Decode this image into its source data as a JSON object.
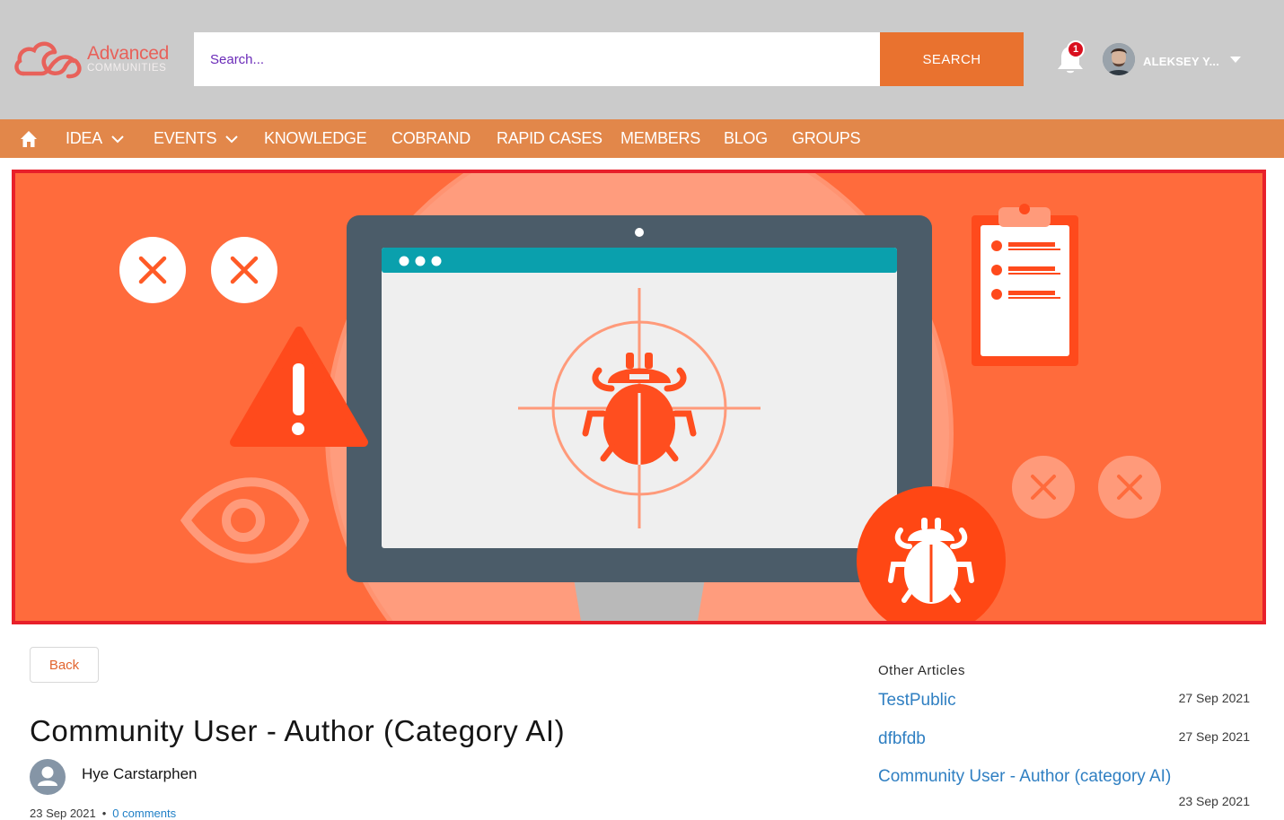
{
  "brand": {
    "line1": "Advanced",
    "line2": "COMMUNITIES",
    "logo_color": "#e8615a"
  },
  "search": {
    "placeholder": "Search...",
    "value": "",
    "button_label": "SEARCH",
    "button_color": "#e9722f"
  },
  "notifications": {
    "count": "1",
    "badge_color": "#d90f1e"
  },
  "user": {
    "name": "ALEKSEY Y..."
  },
  "nav": {
    "home_icon": "home-icon",
    "items": [
      {
        "label": "IDEA",
        "has_dropdown": true
      },
      {
        "label": "EVENTS",
        "has_dropdown": true
      },
      {
        "label": "KNOWLEDGE",
        "has_dropdown": false
      },
      {
        "label": "COBRAND",
        "has_dropdown": false
      },
      {
        "label": "RAPID CASES",
        "has_dropdown": false
      },
      {
        "label": "MEMBERS",
        "has_dropdown": false
      },
      {
        "label": "BLOG",
        "has_dropdown": false
      },
      {
        "label": "GROUPS",
        "has_dropdown": false
      }
    ],
    "bar_color": "#e2874a"
  },
  "banner": {
    "accent": "#ff6b3c",
    "icons": [
      "close-circle-icon",
      "warning-icon",
      "eye-icon",
      "bug-icon",
      "target-icon",
      "clipboard-icon",
      "monitor-icon"
    ]
  },
  "article": {
    "back_label": "Back",
    "title": "Community User - Author (Category AI)",
    "author": "Hye Carstarphen",
    "date": "23 Sep 2021",
    "comments": "0 comments"
  },
  "other_articles": {
    "heading": "Other Articles",
    "items": [
      {
        "title": "TestPublic",
        "date": "27 Sep 2021"
      },
      {
        "title": "dfbfdb",
        "date": "27 Sep 2021"
      },
      {
        "title": "Community User - Author (category AI)",
        "date": "23 Sep 2021"
      }
    ],
    "link_color": "#2f7fc2"
  }
}
